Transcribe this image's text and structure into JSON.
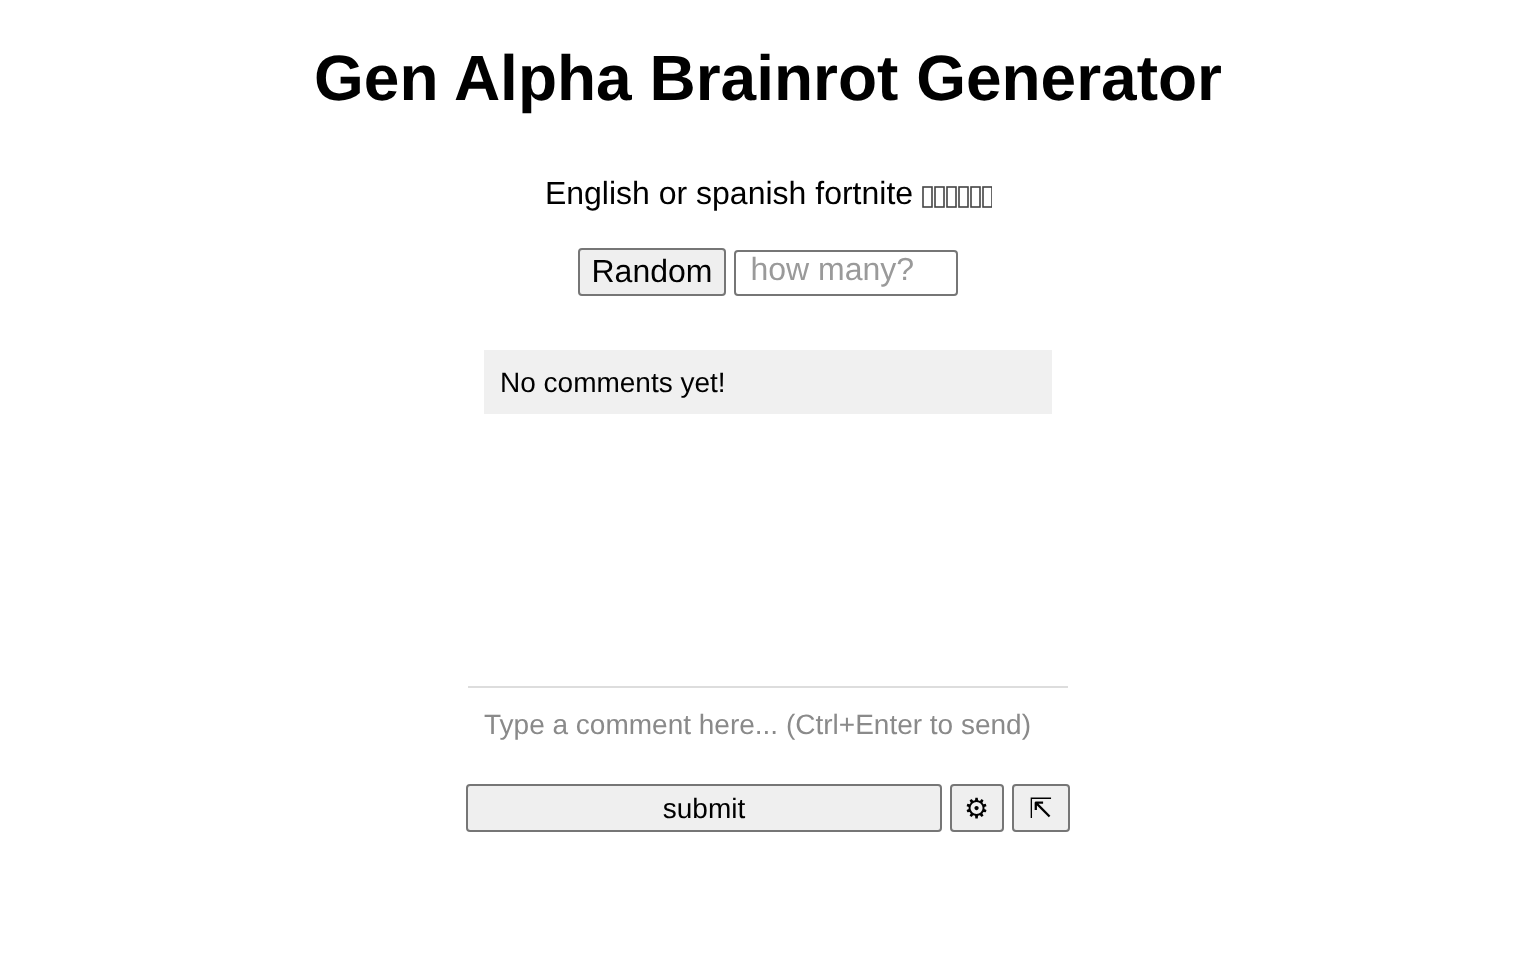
{
  "title": "Gen Alpha Brainrot Generator",
  "subtitle": {
    "text": "English or spanish fortnite",
    "missing_glyphs": true
  },
  "random_button": "Random",
  "count_field": {
    "placeholder": "how many?"
  },
  "comments": {
    "empty_text": "No comments yet!"
  },
  "comment_field": {
    "placeholder": "Type a comment here... (Ctrl+Enter to send)"
  },
  "buttons": [
    {
      "kind": "submit",
      "label": "submit"
    },
    {
      "kind": "settings",
      "label": "⚙"
    },
    {
      "kind": "expand",
      "label": "⇱"
    }
  ]
}
